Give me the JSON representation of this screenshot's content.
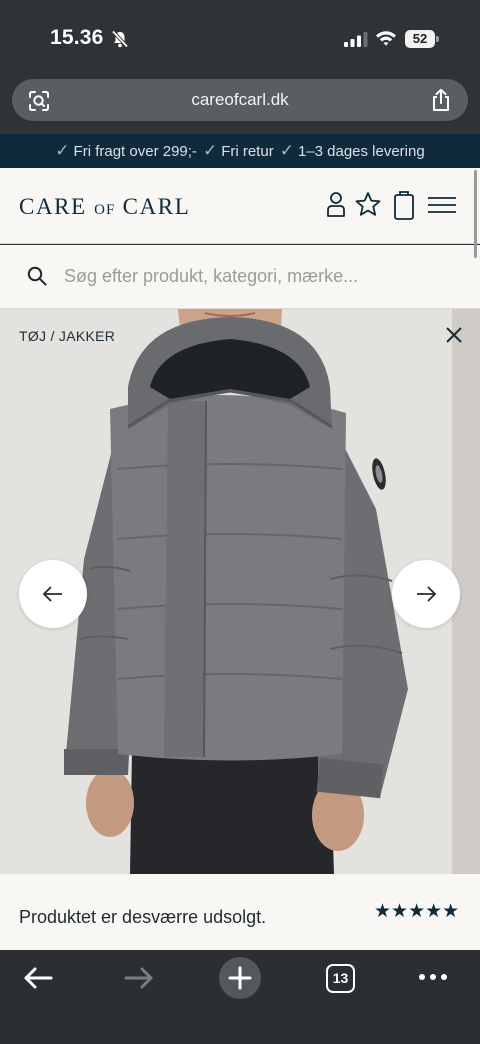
{
  "status_bar": {
    "time": "15.36",
    "battery": "52"
  },
  "browser": {
    "url": "careofcarl.dk",
    "tabs_count": "13"
  },
  "promo": {
    "items": [
      "Fri fragt over 299;-",
      "Fri retur",
      "1–3 dages levering"
    ]
  },
  "header": {
    "logo_left": "CARE",
    "logo_of": "OF",
    "logo_right": "CARL"
  },
  "search": {
    "placeholder": "Søg efter produkt, kategori, mærke..."
  },
  "product": {
    "breadcrumb": "TØJ / JAKKER",
    "status_text": "Produktet er desværre udsolgt.",
    "rating": 5,
    "stars": "★★★★★"
  },
  "colors": {
    "navy": "#0f2a3a",
    "chrome": "#303336",
    "page_bg": "#f8f7f3",
    "jacket": "#75767a"
  },
  "icons": [
    "bell-slash-icon",
    "signal-icon",
    "wifi-icon",
    "lens-icon",
    "share-icon",
    "check-icon",
    "user-icon",
    "star-icon",
    "bag-icon",
    "menu-icon",
    "search-icon",
    "close-icon",
    "arrow-left-icon",
    "arrow-right-icon",
    "back-icon",
    "forward-icon",
    "plus-icon",
    "more-icon"
  ]
}
